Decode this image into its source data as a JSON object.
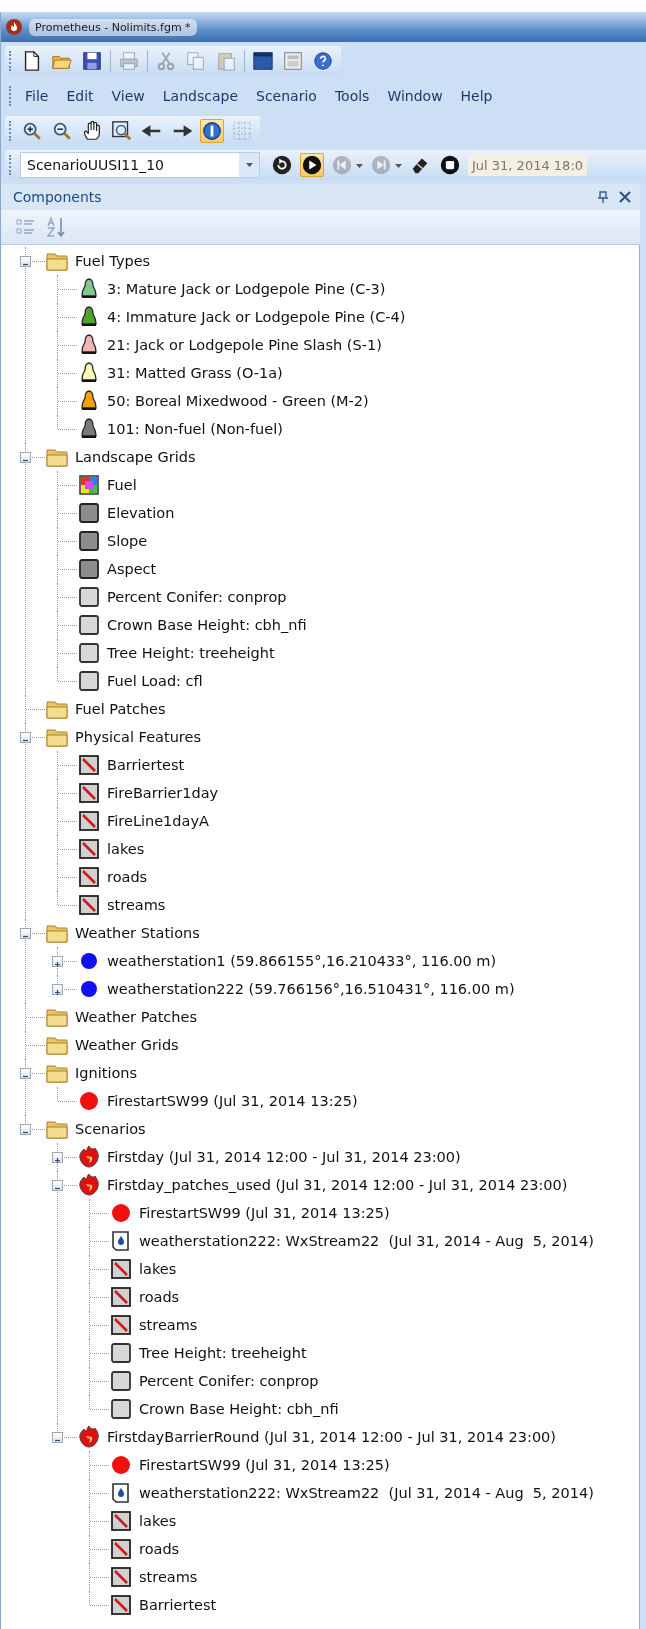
{
  "window": {
    "title": "Prometheus - Nolimits.fgm *"
  },
  "file_toolbar": [
    {
      "kind": "new",
      "disabled": false
    },
    {
      "kind": "open",
      "disabled": false
    },
    {
      "kind": "save",
      "disabled": false
    },
    {
      "kind": "separator"
    },
    {
      "kind": "print",
      "disabled": true
    },
    {
      "kind": "separator"
    },
    {
      "kind": "cut",
      "disabled": true
    },
    {
      "kind": "copy",
      "disabled": true
    },
    {
      "kind": "paste",
      "disabled": true
    },
    {
      "kind": "separator"
    },
    {
      "kind": "window",
      "disabled": false
    },
    {
      "kind": "calculator",
      "disabled": false
    },
    {
      "kind": "help",
      "disabled": false
    }
  ],
  "menu": [
    "File",
    "Edit",
    "View",
    "Landscape",
    "Scenario",
    "Tools",
    "Window",
    "Help"
  ],
  "map_toolbar": [
    {
      "kind": "zoom-in",
      "selected": false
    },
    {
      "kind": "zoom-out",
      "selected": false
    },
    {
      "kind": "pan",
      "selected": false
    },
    {
      "kind": "zoom-extent",
      "selected": false
    },
    {
      "kind": "back",
      "selected": false
    },
    {
      "kind": "forward",
      "selected": false
    },
    {
      "kind": "info",
      "selected": true
    },
    {
      "kind": "grid",
      "selected": false,
      "disabled": true
    }
  ],
  "scenario_toolbar": {
    "scenario": "ScenarioUUSI11_10",
    "buttons": [
      {
        "kind": "reset",
        "selected": false,
        "disabled": false
      },
      {
        "kind": "play",
        "selected": true,
        "disabled": false
      },
      {
        "kind": "step-back",
        "selected": false,
        "disabled": true,
        "dropdown": true
      },
      {
        "kind": "step-forward",
        "selected": false,
        "disabled": true,
        "dropdown": true
      },
      {
        "kind": "eraser",
        "selected": false,
        "disabled": false
      },
      {
        "kind": "stop",
        "selected": false,
        "disabled": false
      }
    ],
    "time": "Jul 31, 2014 18:0"
  },
  "panel": {
    "title": "Components"
  },
  "tree": [
    {
      "label": "Fuel Types",
      "kind": "folder",
      "expanded": true,
      "children": [
        {
          "label": "3: Mature Jack or Lodgepole Pine (C-3)",
          "kind": "fueltype",
          "color": "#7fc98f"
        },
        {
          "label": "4: Immature Jack or Lodgepole Pine (C-4)",
          "kind": "fueltype",
          "color": "#4ea52a"
        },
        {
          "label": "21: Jack or Lodgepole Pine Slash (S-1)",
          "kind": "fueltype",
          "color": "#f4b4b4"
        },
        {
          "label": "31: Matted Grass (O-1a)",
          "kind": "fueltype",
          "color": "#fbf5b8"
        },
        {
          "label": "50: Boreal Mixedwood - Green (M-2)",
          "kind": "fueltype",
          "color": "#f7a10a"
        },
        {
          "label": "101: Non-fuel (Non-fuel)",
          "kind": "fueltype",
          "color": "#7a7a7a"
        }
      ]
    },
    {
      "label": "Landscape Grids",
      "kind": "folder",
      "expanded": true,
      "children": [
        {
          "label": "Fuel",
          "kind": "fuelgrid"
        },
        {
          "label": "Elevation",
          "kind": "terraingrid"
        },
        {
          "label": "Slope",
          "kind": "terraingrid"
        },
        {
          "label": "Aspect",
          "kind": "terraingrid"
        },
        {
          "label": "Percent Conifer: conprop",
          "kind": "grid"
        },
        {
          "label": "Crown Base Height: cbh_nfi",
          "kind": "grid"
        },
        {
          "label": "Tree Height: treeheight",
          "kind": "grid"
        },
        {
          "label": "Fuel Load: cfl",
          "kind": "grid"
        }
      ]
    },
    {
      "label": "Fuel Patches",
      "kind": "folder"
    },
    {
      "label": "Physical Features",
      "kind": "folder",
      "expanded": true,
      "children": [
        {
          "label": "Barriertest",
          "kind": "feature"
        },
        {
          "label": "FireBarrier1day",
          "kind": "feature"
        },
        {
          "label": "FireLine1dayA",
          "kind": "feature"
        },
        {
          "label": "lakes",
          "kind": "feature"
        },
        {
          "label": "roads",
          "kind": "feature"
        },
        {
          "label": "streams",
          "kind": "feature"
        }
      ]
    },
    {
      "label": "Weather Stations",
      "kind": "folder",
      "expanded": true,
      "children": [
        {
          "label": "weatherstation1 (59.866155°,16.210433°, 116.00 m)",
          "kind": "station",
          "expanded": false
        },
        {
          "label": "weatherstation222 (59.766156°,16.510431°, 116.00 m)",
          "kind": "station",
          "expanded": false
        }
      ]
    },
    {
      "label": "Weather Patches",
      "kind": "folder"
    },
    {
      "label": "Weather Grids",
      "kind": "folder"
    },
    {
      "label": "Ignitions",
      "kind": "folder",
      "expanded": true,
      "children": [
        {
          "label": "FirestartSW99 (Jul 31, 2014 13:25)",
          "kind": "ignition"
        }
      ]
    },
    {
      "label": "Scenarios",
      "kind": "folder",
      "expanded": true,
      "children": [
        {
          "label": "Firstday (Jul 31, 2014 12:00 - Jul 31, 2014 23:00)",
          "kind": "scenario",
          "expanded": false
        },
        {
          "label": "Firstday_patches_used (Jul 31, 2014 12:00 - Jul 31, 2014 23:00)",
          "kind": "scenario",
          "expanded": true,
          "children": [
            {
              "label": "FirestartSW99 (Jul 31, 2014 13:25)",
              "kind": "ignition"
            },
            {
              "label": "weatherstation222: WxStream22  (Jul 31, 2014 - Aug  5, 2014)",
              "kind": "stream"
            },
            {
              "label": "lakes",
              "kind": "feature"
            },
            {
              "label": "roads",
              "kind": "feature"
            },
            {
              "label": "streams",
              "kind": "feature"
            },
            {
              "label": "Tree Height: treeheight",
              "kind": "grid"
            },
            {
              "label": "Percent Conifer: conprop",
              "kind": "grid"
            },
            {
              "label": "Crown Base Height: cbh_nfi",
              "kind": "grid"
            }
          ]
        },
        {
          "label": "FirstdayBarrierRound (Jul 31, 2014 12:00 - Jul 31, 2014 23:00)",
          "kind": "scenario",
          "expanded": true,
          "children": [
            {
              "label": "FirestartSW99 (Jul 31, 2014 13:25)",
              "kind": "ignition"
            },
            {
              "label": "weatherstation222: WxStream22  (Jul 31, 2014 - Aug  5, 2014)",
              "kind": "stream"
            },
            {
              "label": "lakes",
              "kind": "feature"
            },
            {
              "label": "roads",
              "kind": "feature"
            },
            {
              "label": "streams",
              "kind": "feature"
            },
            {
              "label": "Barriertest",
              "kind": "feature"
            }
          ]
        }
      ]
    }
  ]
}
